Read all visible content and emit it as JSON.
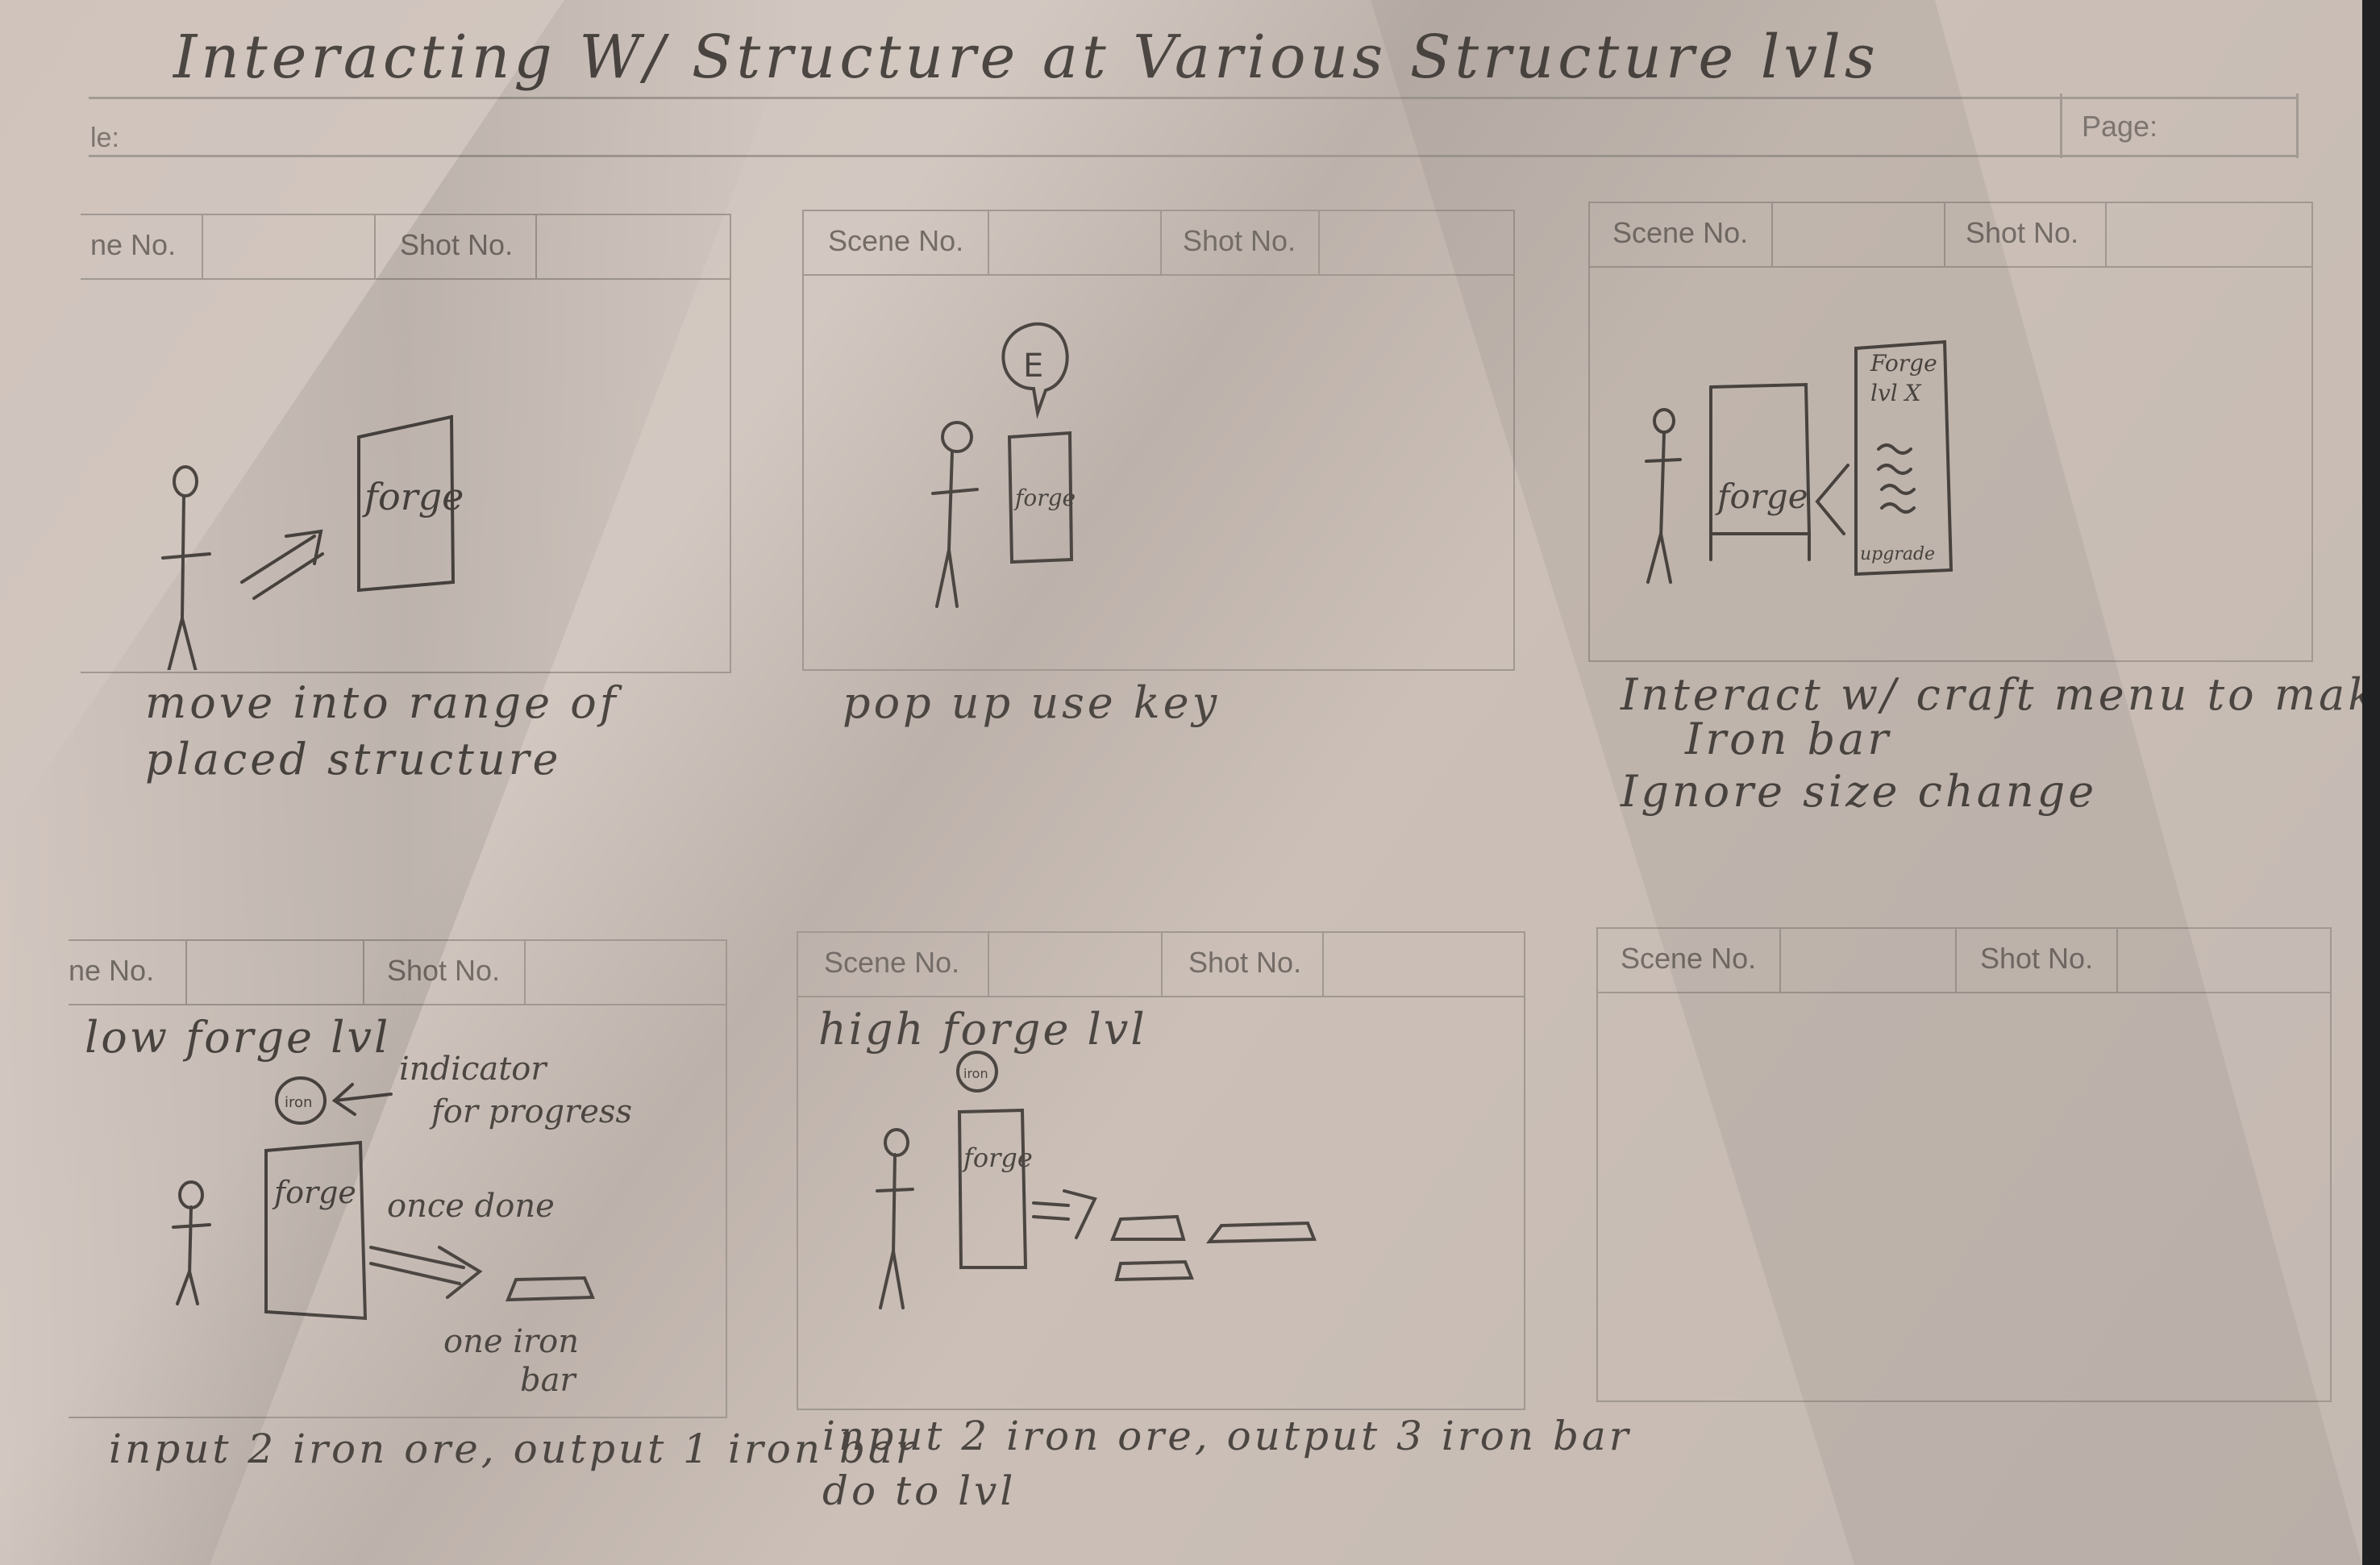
{
  "sheet": {
    "title": "Interacting W/ Structure at Various Structure lvls",
    "title_label": "le:",
    "page_label": "Page:"
  },
  "panel_headers": {
    "scene": "Scene No.",
    "shot": "Shot No.",
    "scene_cut": "ne No."
  },
  "panels": [
    {
      "caption": [
        "move into range of",
        "placed structure"
      ],
      "sketch_text": {
        "forge": "forge"
      }
    },
    {
      "caption": [
        "pop up use key"
      ],
      "sketch_text": {
        "forge": "forge",
        "key": "E"
      }
    },
    {
      "caption": [
        "Interact w/ craft menu to make",
        "Iron bar",
        "Ignore size change"
      ],
      "sketch_text": {
        "forge": "forge",
        "menu_title": "Forge",
        "menu_level": "lvl X",
        "menu_button": "upgrade"
      }
    },
    {
      "caption": [
        "input 2 iron ore, output 1 iron bar"
      ],
      "sketch_text": {
        "heading": "low forge lvl",
        "indicator": [
          "indicator",
          "for progress"
        ],
        "badge": "iron",
        "forge": "forge",
        "once_done": "once done",
        "result": [
          "one iron",
          "bar"
        ]
      }
    },
    {
      "caption": [
        "input 2 iron ore, output 3 iron bar",
        "do to lvl"
      ],
      "sketch_text": {
        "heading": "high forge lvl",
        "badge": "iron",
        "forge": "forge"
      }
    },
    {
      "caption": [],
      "sketch_text": {}
    }
  ],
  "colors": {
    "paper": "#cfc3bc",
    "pencil": "#4c4642",
    "print_lines": "#a19892",
    "background": "#1f2021"
  }
}
